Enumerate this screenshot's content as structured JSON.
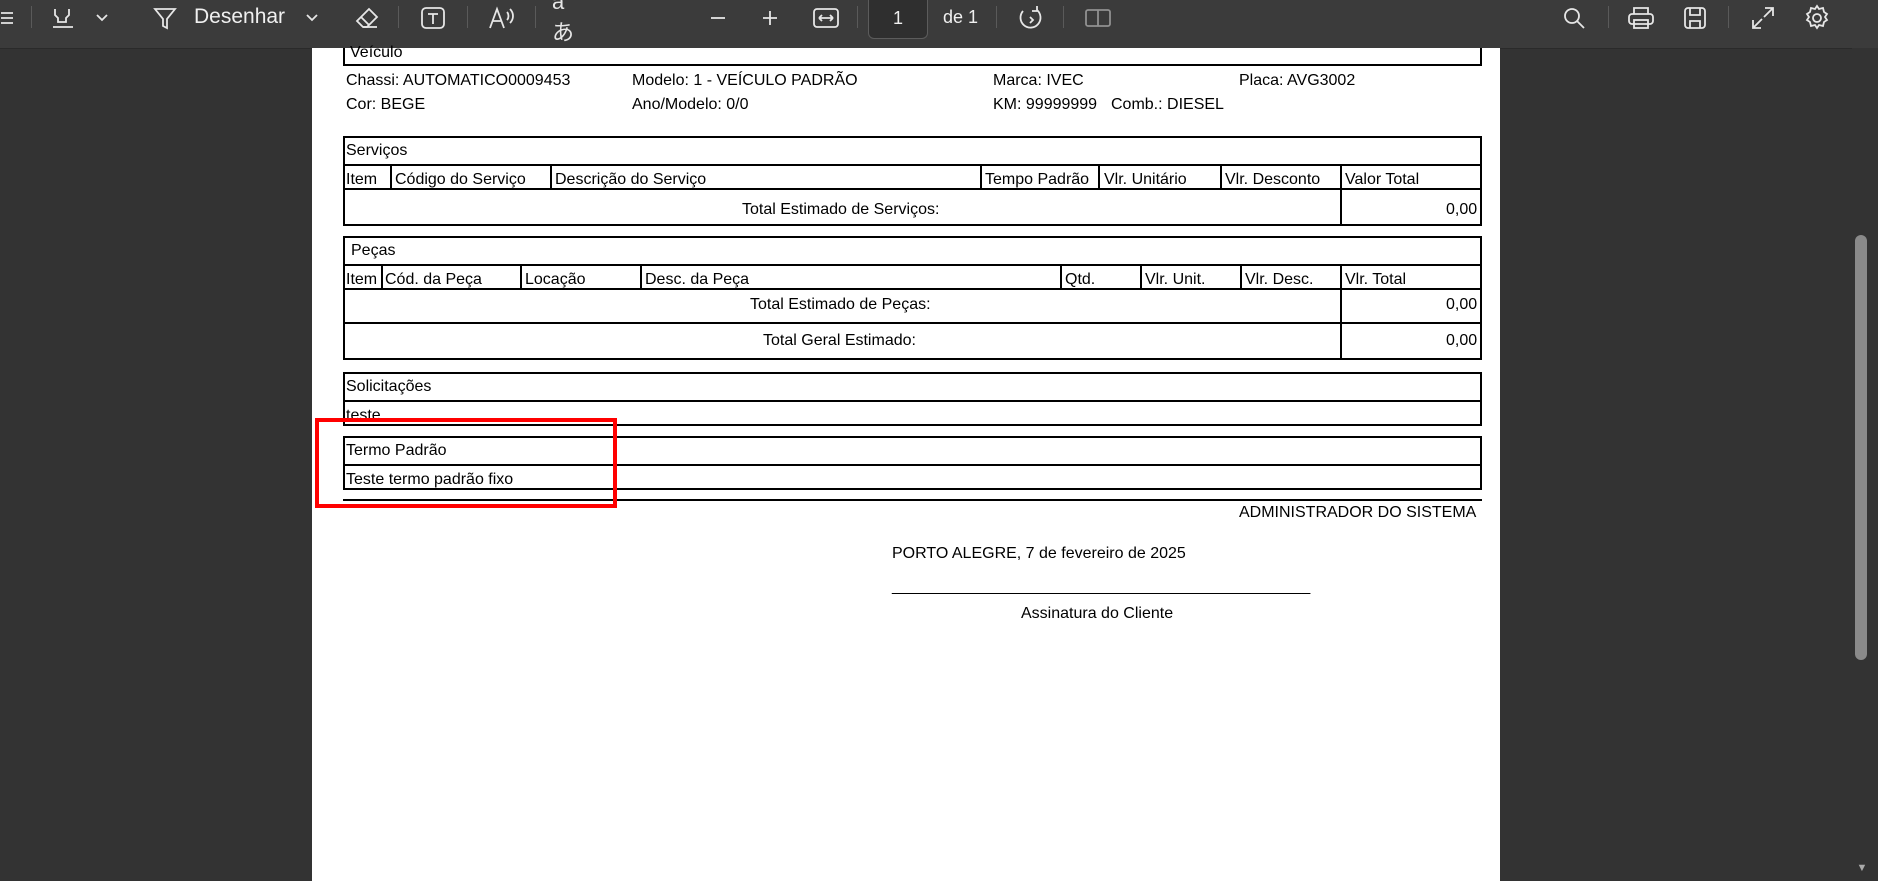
{
  "toolbar": {
    "draw_label": "Desenhar",
    "page_number": "1",
    "page_total": "de 1"
  },
  "document": {
    "veiculo": {
      "title": "Veículo",
      "chassi": "Chassi: AUTOMATICO0009453",
      "modelo": "Modelo: 1 - VEÍCULO PADRÃO",
      "marca": "Marca: IVEC",
      "placa": "Placa: AVG3002",
      "cor": "Cor: BEGE",
      "ano_modelo": "Ano/Modelo: 0/0",
      "km": "KM: 99999999",
      "comb": "Comb.: DIESEL"
    },
    "servicos": {
      "title": "Serviços",
      "columns": [
        "Item",
        "Código do Serviço",
        "Descrição do Serviço",
        "Tempo Padrão",
        "Vlr. Unitário",
        "Vlr. Desconto",
        "Valor Total"
      ],
      "total_label": "Total Estimado de Serviços:",
      "total_value": "0,00"
    },
    "pecas": {
      "title": "Peças",
      "columns": [
        "Item",
        "Cód. da Peça",
        "Locação",
        "Desc. da Peça",
        "Qtd.",
        "Vlr. Unit.",
        "Vlr. Desc.",
        "Vlr. Total"
      ],
      "total_label": "Total Estimado de Peças:",
      "total_value": "0,00",
      "geral_label": "Total Geral Estimado:",
      "geral_value": "0,00"
    },
    "solicitacoes": {
      "title": "Solicitações",
      "text": "teste"
    },
    "termo": {
      "title": "Termo Padrão",
      "text": "Teste termo padrão fixo"
    },
    "admin": "ADMINISTRADOR DO SISTEMA",
    "place_date": "PORTO ALEGRE, 7 de fevereiro de 2025",
    "signature_line": "_______________________________________________",
    "signature_label": "Assinatura do Cliente"
  },
  "colors": {
    "toolbar_bg": "#3b3b3b",
    "viewer_bg": "#333333",
    "highlight": "#ff0000"
  }
}
